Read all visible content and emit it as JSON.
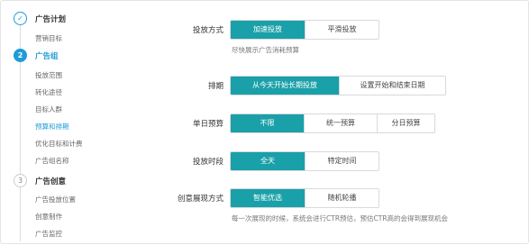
{
  "stepper": {
    "steps": [
      {
        "title": "广告计划",
        "marker": "✓",
        "status": "done",
        "items": [
          "营销目标"
        ]
      },
      {
        "title": "广告组",
        "marker": "2",
        "status": "active",
        "items": [
          "投放范围",
          "转化途径",
          "目标人群",
          "预算和排期",
          "优化目标和计费",
          "广告组名称"
        ],
        "selected_item": "预算和排期"
      },
      {
        "title": "广告创意",
        "marker": "3",
        "status": "todo",
        "items": [
          "广告投放位置",
          "创意制作",
          "广告监控"
        ]
      }
    ]
  },
  "form": {
    "delivery_method": {
      "label": "投放方式",
      "options": [
        "加速投放",
        "平滑投放"
      ],
      "selected": "加速投放",
      "hint": "尽快展示广告消耗预算"
    },
    "schedule": {
      "label": "排期",
      "options": [
        "从今天开始长期投放",
        "设置开始和结束日期"
      ],
      "selected": "从今天开始长期投放"
    },
    "daily_budget": {
      "label": "单日预算",
      "options": [
        "不限",
        "统一预算",
        "分日预算"
      ],
      "selected": "不限"
    },
    "time_period": {
      "label": "投放时段",
      "options": [
        "全天",
        "特定时间"
      ],
      "selected": "全天"
    },
    "creative_display": {
      "label": "创意展现方式",
      "options": [
        "智能优选",
        "随机轮播"
      ],
      "selected": "智能优选",
      "hint": "每一次展现的时候，系统会进行CTR预估，预估CTR高的会得到展现机会"
    }
  },
  "colors": {
    "accent": "#1aa0a8",
    "step_blue": "#1f9bd8"
  }
}
